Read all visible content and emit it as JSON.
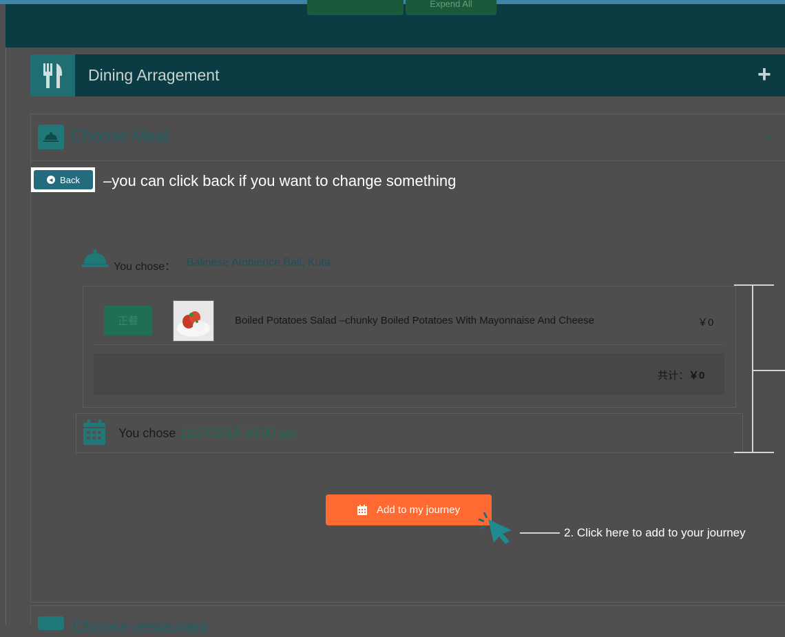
{
  "top": {
    "tab1": "",
    "tab2": "Expend All"
  },
  "dining": {
    "title": "Dining Arragement",
    "expand": "+"
  },
  "meal": {
    "title": "Choose Meal",
    "back": "Back",
    "back_note": "–you can click back if you want to change something",
    "chose_label": "You chose：",
    "restaurant": "Balinese Ambience,Bali, Kuta",
    "item": {
      "tag": "正餐",
      "description": "Boiled Potatoes Salad –chunky Boiled Potatoes With Mayonnaise And Cheese",
      "price": "￥0"
    },
    "total_label": "共计：",
    "total_value": "￥0",
    "date_label": "You chose",
    "date_value": "11/14/2018 10:00 am",
    "add_button": "Add to my journey",
    "annotation": "2. Click here to add to your journey"
  },
  "next": {
    "title": "Choose restaurant"
  },
  "colors": {
    "accent": "#217878",
    "button": "#ff6a33",
    "header": "#0c3c43"
  }
}
